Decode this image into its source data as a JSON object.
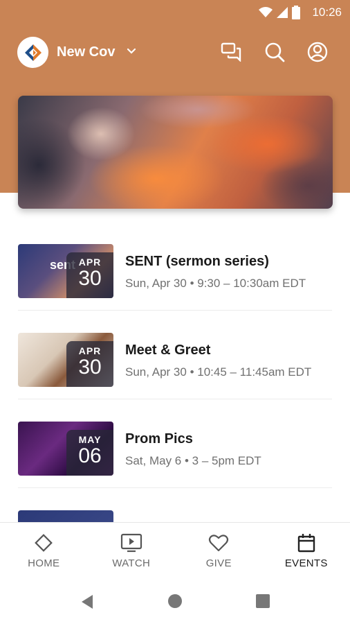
{
  "status": {
    "time": "10:26"
  },
  "app": {
    "title": "New Cov"
  },
  "events": [
    {
      "month": "APR",
      "day": "30",
      "title": "SENT (sermon series)",
      "meta": "Sun, Apr 30 • 9:30 – 10:30am EDT",
      "thumb_text": "sent"
    },
    {
      "month": "APR",
      "day": "30",
      "title": "Meet & Greet",
      "meta": "Sun, Apr 30 • 10:45 – 11:45am EDT",
      "thumb_text": ""
    },
    {
      "month": "MAY",
      "day": "06",
      "title": "Prom Pics",
      "meta": "Sat, May 6 • 3 – 5pm EDT",
      "thumb_text": ""
    }
  ],
  "nav": {
    "home": "HOME",
    "watch": "WATCH",
    "give": "GIVE",
    "events": "EVENTS"
  },
  "colors": {
    "header": "#c98455",
    "text": "#1a1a1a",
    "muted": "#707070"
  },
  "icons": [
    "wifi-icon",
    "signal-icon",
    "battery-icon",
    "logo-icon",
    "chevron-down-icon",
    "chat-icon",
    "search-icon",
    "account-icon",
    "home-icon",
    "watch-icon",
    "give-icon",
    "events-icon",
    "back-icon",
    "home-circle-icon",
    "recents-icon"
  ]
}
